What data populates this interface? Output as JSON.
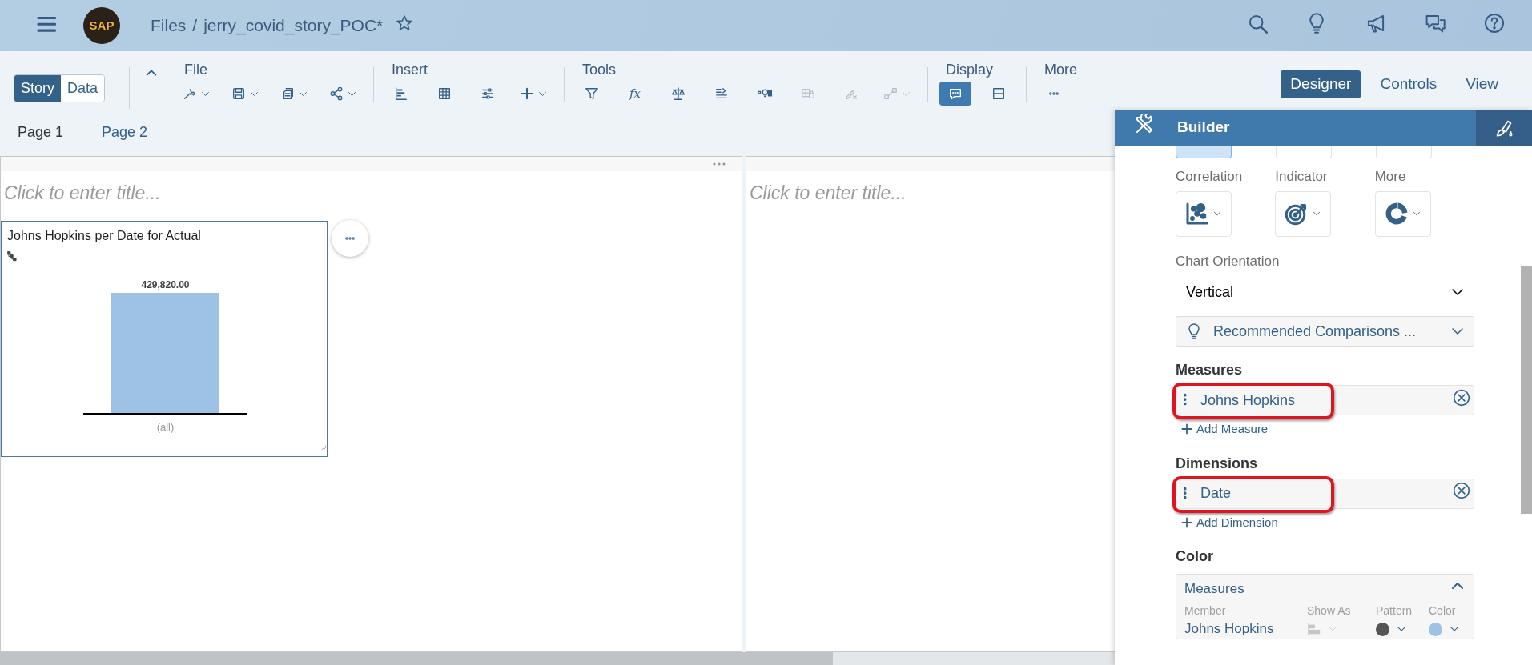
{
  "shell": {
    "logo": "SAP",
    "breadcrumb": {
      "root": "Files",
      "separator": "/",
      "current": "jerry_covid_story_POC*"
    },
    "favorite": false,
    "actions": [
      {
        "kind": "search"
      },
      {
        "kind": "bulb"
      },
      {
        "kind": "megaphone"
      },
      {
        "kind": "chat"
      },
      {
        "kind": "help"
      }
    ]
  },
  "mode_toggle": [
    {
      "label": "Story",
      "selected": true
    },
    {
      "label": "Data",
      "selected": false
    }
  ],
  "toolbar_groups": [
    {
      "label": "File",
      "tools": [
        {
          "kind": "wrench",
          "dropdown": true,
          "disabled": false,
          "selected": false
        },
        {
          "kind": "save",
          "dropdown": true,
          "disabled": false,
          "selected": false
        },
        {
          "kind": "copy",
          "dropdown": true,
          "disabled": false,
          "selected": false
        },
        {
          "kind": "share",
          "dropdown": true,
          "disabled": false,
          "selected": false
        }
      ]
    },
    {
      "label": "Insert",
      "tools": [
        {
          "kind": "barchart",
          "dropdown": false,
          "disabled": false,
          "selected": false
        },
        {
          "kind": "table",
          "dropdown": false,
          "disabled": false,
          "selected": false
        },
        {
          "kind": "sliders",
          "dropdown": false,
          "disabled": false,
          "selected": false
        },
        {
          "kind": "plus",
          "dropdown": true,
          "disabled": false,
          "selected": false
        }
      ]
    },
    {
      "label": "Tools",
      "tools": [
        {
          "kind": "filter",
          "dropdown": false,
          "disabled": false,
          "selected": false
        },
        {
          "kind": "text",
          "text": "fx",
          "dropdown": false,
          "disabled": false,
          "selected": false
        },
        {
          "kind": "balance",
          "dropdown": false,
          "disabled": false,
          "selected": false
        },
        {
          "kind": "listcompare",
          "dropdown": false,
          "disabled": false,
          "selected": false
        },
        {
          "kind": "bulbchart",
          "dropdown": false,
          "disabled": false,
          "selected": false
        },
        {
          "kind": "tablelock",
          "dropdown": false,
          "disabled": true,
          "selected": false
        },
        {
          "kind": "pencilx",
          "dropdown": false,
          "disabled": true,
          "selected": false
        },
        {
          "kind": "nodes",
          "dropdown": true,
          "disabled": true,
          "selected": false
        }
      ]
    },
    {
      "label": "Display",
      "tools": [
        {
          "kind": "comment",
          "dropdown": false,
          "disabled": false,
          "selected": true
        },
        {
          "kind": "layout",
          "dropdown": false,
          "disabled": false,
          "selected": false
        }
      ]
    },
    {
      "label": "More",
      "tools": [
        {
          "kind": "dots",
          "dropdown": false,
          "disabled": false,
          "selected": false
        }
      ]
    }
  ],
  "view_tabs": [
    {
      "label": "Designer",
      "selected": true
    },
    {
      "label": "Controls",
      "selected": false
    },
    {
      "label": "View",
      "selected": false
    }
  ],
  "pages": [
    {
      "label": "Page 1",
      "selected": true
    },
    {
      "label": "Page 2",
      "selected": false
    }
  ],
  "panels": [
    {
      "title_placeholder": "Click to enter title...",
      "widget": {
        "title": "Johns Hopkins per Date for Actual",
        "bar_label": "429,820.00",
        "category": "(all)"
      }
    },
    {
      "title_placeholder": "Click to enter title..."
    }
  ],
  "builder": {
    "title": "Builder",
    "top_tiles": [
      {
        "selected": true
      },
      {
        "selected": false
      },
      {
        "selected": false
      }
    ],
    "chart_types": [
      {
        "label": "Correlation",
        "kind": "scatter"
      },
      {
        "label": "Indicator",
        "kind": "target"
      },
      {
        "label": "More",
        "kind": "donut"
      }
    ],
    "orientation": {
      "label": "Chart Orientation",
      "value": "Vertical"
    },
    "recommended": {
      "label": "Recommended Comparisons ..."
    },
    "sections": [
      {
        "heading": "Measures",
        "items": [
          {
            "label": "Johns Hopkins",
            "highlighted": true
          }
        ],
        "add_label": "Add Measure"
      },
      {
        "heading": "Dimensions",
        "items": [
          {
            "label": "Date",
            "highlighted": true
          }
        ],
        "add_label": "Add Dimension"
      }
    ],
    "color": {
      "heading": "Color",
      "group": "Measures",
      "expanded": true,
      "columns": [
        "Member",
        "Show As",
        "Pattern",
        "Color"
      ],
      "rows": [
        {
          "member": "Johns Hopkins",
          "color": "#9dc2e5"
        }
      ]
    }
  }
}
